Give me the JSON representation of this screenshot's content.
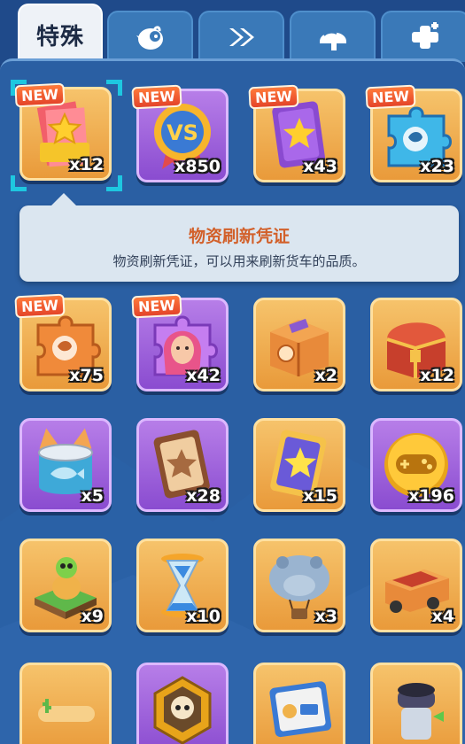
{
  "tabs": [
    {
      "label": "特殊",
      "active": true
    },
    {
      "icon": "chicken-icon"
    },
    {
      "icon": "fast-forward-icon"
    },
    {
      "icon": "helmet-icon"
    },
    {
      "icon": "plus-bandage-icon"
    }
  ],
  "badge_label": "NEW",
  "items": [
    {
      "name": "ticket",
      "count": "x12",
      "isNew": true,
      "selected": true
    },
    {
      "name": "vs-medal",
      "count": "x850",
      "isNew": true
    },
    {
      "name": "star-card-purple",
      "count": "x43",
      "isNew": true
    },
    {
      "name": "blue-puzzle-piece",
      "count": "x23",
      "isNew": true
    },
    {
      "name": "orange-puzzle-piece",
      "count": "x75",
      "isNew": true
    },
    {
      "name": "hero-portrait-puzzle",
      "count": "x42",
      "isNew": true
    },
    {
      "name": "orange-supply-crate",
      "count": "x2"
    },
    {
      "name": "red-treasure-chest",
      "count": "x12"
    },
    {
      "name": "fish-can",
      "count": "x5"
    },
    {
      "name": "brown-star-card",
      "count": "x28"
    },
    {
      "name": "gold-star-card",
      "count": "x15"
    },
    {
      "name": "gamepad-coin",
      "count": "x196"
    },
    {
      "name": "turtle-figure",
      "count": "x9"
    },
    {
      "name": "hourglass",
      "count": "x10"
    },
    {
      "name": "hippo-balloon",
      "count": "x3"
    },
    {
      "name": "truck-vehicle",
      "count": "x4"
    },
    {
      "name": "cactus-tile",
      "count": ""
    },
    {
      "name": "skull-badge",
      "count": ""
    },
    {
      "name": "change-id-card",
      "count": ""
    },
    {
      "name": "cannon-character",
      "count": ""
    }
  ],
  "tooltip": {
    "title": "物资刷新凭证",
    "desc": "物资刷新凭证，可以用来刷新货车的品质。"
  },
  "colors": {
    "panel_bg": "#2a5fa3",
    "tab_bg": "#3a79b8",
    "title_orange": "#d2602a",
    "selection_cyan": "#1ec7e0"
  }
}
